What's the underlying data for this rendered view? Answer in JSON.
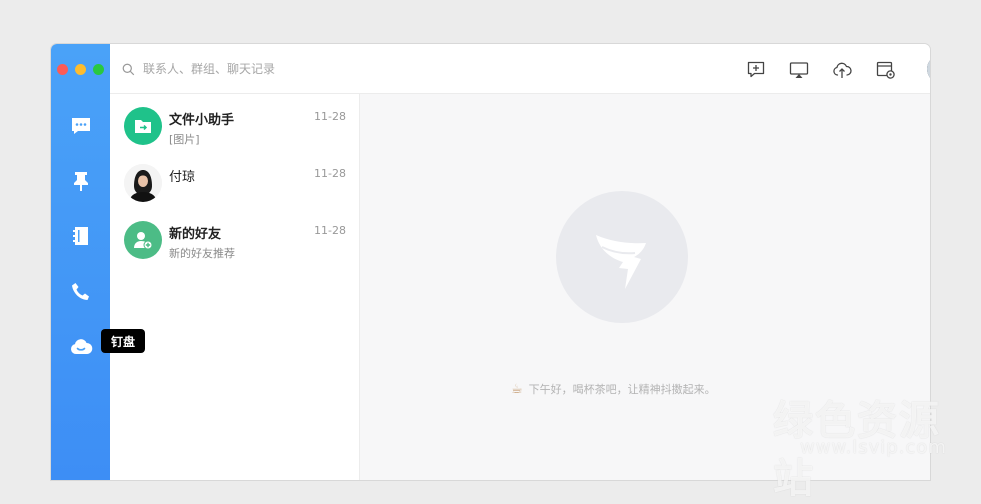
{
  "search": {
    "placeholder": "联系人、群组、聊天记录"
  },
  "sidebar": {
    "items": [
      {
        "name": "messages",
        "icon": "chat-bubble-icon"
      },
      {
        "name": "pin",
        "icon": "pin-icon"
      },
      {
        "name": "contacts",
        "icon": "address-book-icon"
      },
      {
        "name": "phone",
        "icon": "phone-icon"
      },
      {
        "name": "cloud-disk",
        "icon": "cloud-icon"
      }
    ],
    "tooltip": "钉盘"
  },
  "toolbar": {
    "icons": [
      "new-chat-icon",
      "screen-share-icon",
      "cloud-upload-icon",
      "settings-calendar-icon",
      "user-avatar",
      "chevron-down-icon"
    ]
  },
  "conversations": [
    {
      "name": "文件小助手",
      "preview": "[图片]",
      "time": "11-28",
      "avatar_color": "#1fc28a"
    },
    {
      "name": "付琼",
      "preview": "",
      "time": "11-28",
      "avatar_color": "#ffffff"
    },
    {
      "name": "新的好友",
      "preview": "新的好友推荐",
      "time": "11-28",
      "avatar_color": "#4cbc86"
    }
  ],
  "main": {
    "greeting": "下午好，喝杯茶吧，让精神抖擞起来。"
  },
  "watermark": {
    "text": "绿色资源站",
    "url": "www.lsvip.com"
  }
}
